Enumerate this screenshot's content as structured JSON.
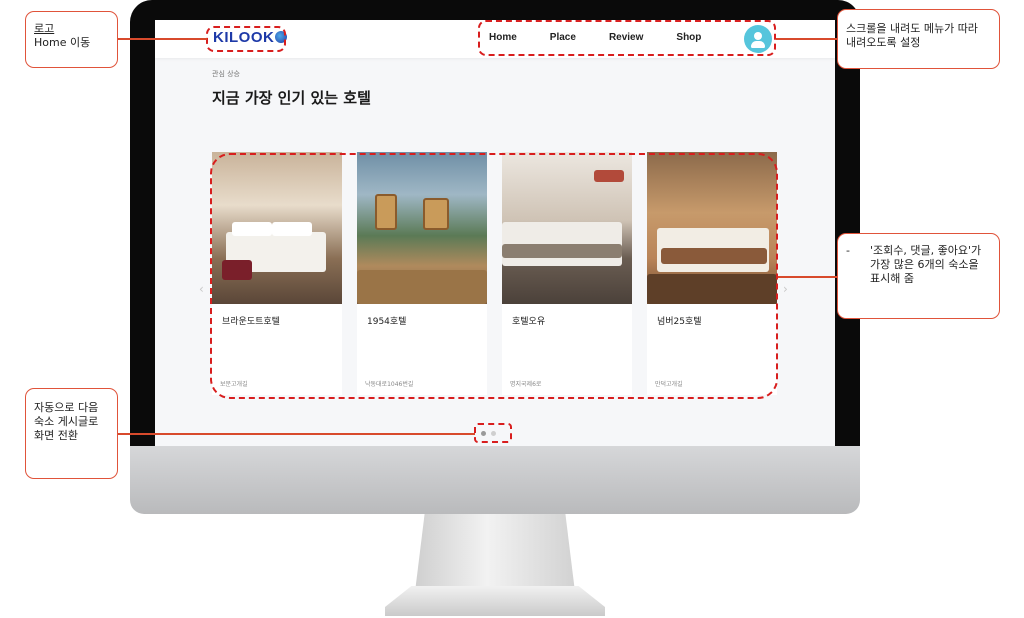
{
  "header": {
    "logo_text": "KILOOK",
    "nav": [
      "Home",
      "Place",
      "Review",
      "Shop"
    ],
    "avatar_icon": "user-icon"
  },
  "section": {
    "eyebrow": "관심 상승",
    "title": "지금 가장 인기 있는 호텔"
  },
  "hotels": [
    {
      "name": "브라운도트호텔",
      "address": "보문고개길"
    },
    {
      "name": "1954호텔",
      "address": "낙동대로1046번길"
    },
    {
      "name": "호텔오유",
      "address": "명지국제6로"
    },
    {
      "name": "넘버25호텔",
      "address": "만덕고개길"
    }
  ],
  "carousel": {
    "slides": 2,
    "active": 1
  },
  "annotations": {
    "logo": {
      "title": "로고",
      "text": "Home 이동"
    },
    "menu": {
      "text": "스크롤을 내려도 메뉴가 따라 내려오도록 설정"
    },
    "cards": {
      "bullet": "-",
      "text": "'조회수, 댓글, 좋아요'가 가장 많은 6개의 숙소을 표시해 줌"
    },
    "dots": {
      "text": "자동으로 다음 숙소 게시글로 화면 전환"
    }
  },
  "colors": {
    "accent": "#d81e1e",
    "callout_border": "#e0533a",
    "logo": "#1e3aa8",
    "avatar": "#56c5dc"
  }
}
